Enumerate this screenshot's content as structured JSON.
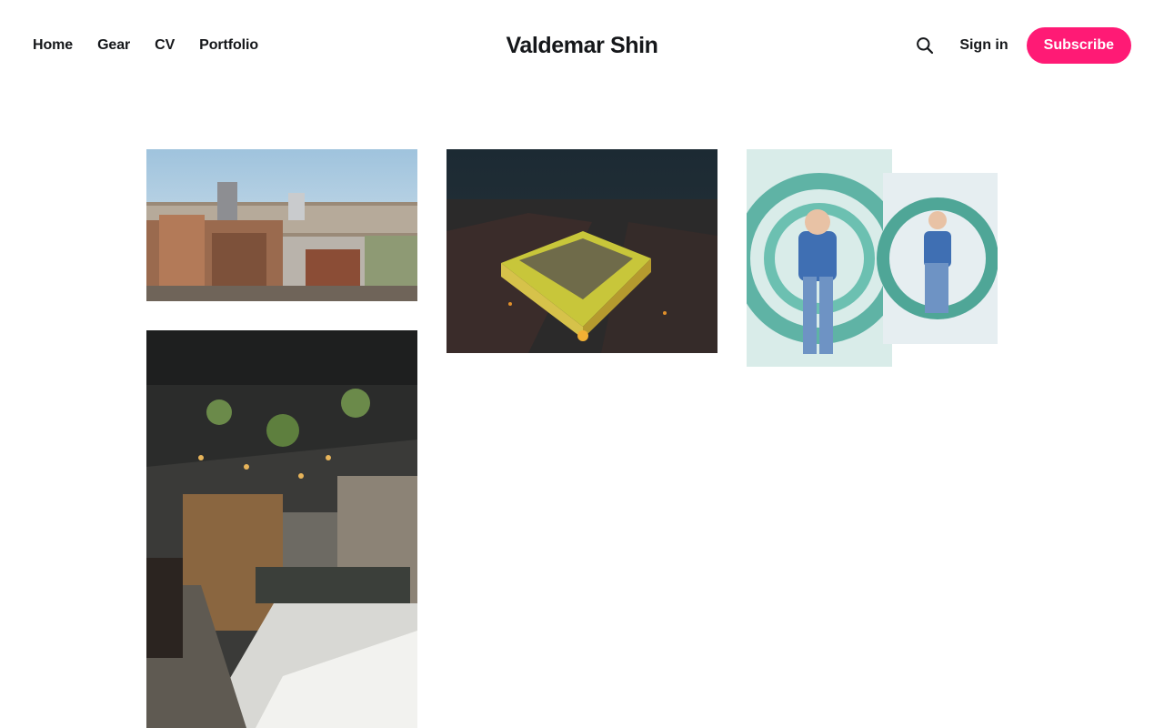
{
  "nav": {
    "items": [
      {
        "label": "Home"
      },
      {
        "label": "Gear"
      },
      {
        "label": "CV"
      },
      {
        "label": "Portfolio"
      }
    ]
  },
  "site": {
    "title": "Valdemar Shin"
  },
  "header": {
    "search_icon": "search-icon",
    "signin_label": "Sign in",
    "subscribe_label": "Subscribe"
  },
  "colors": {
    "accent": "#ff1a75",
    "text": "#15171a",
    "background": "#ffffff"
  },
  "gallery": [
    {
      "name": "city-aerial-photo"
    },
    {
      "name": "night-building-photo"
    },
    {
      "name": "child-sculpture-photo"
    },
    {
      "name": "restaurant-interior-photo"
    }
  ]
}
